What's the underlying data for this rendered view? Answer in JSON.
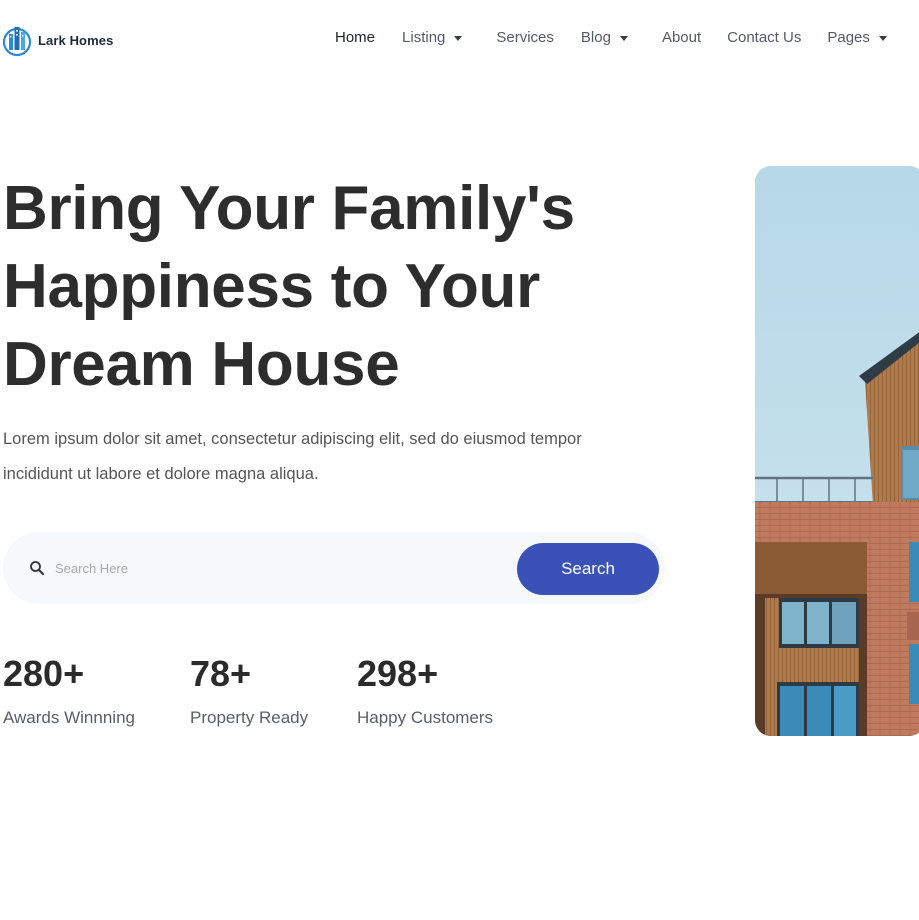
{
  "brand": {
    "name": "Lark Homes",
    "accent_color": "#3a52b8"
  },
  "nav": {
    "items": [
      {
        "label": "Home",
        "active": true,
        "has_dropdown": false
      },
      {
        "label": "Listing",
        "active": false,
        "has_dropdown": true
      },
      {
        "label": "Services",
        "active": false,
        "has_dropdown": false
      },
      {
        "label": "Blog",
        "active": false,
        "has_dropdown": true
      },
      {
        "label": "About",
        "active": false,
        "has_dropdown": false
      },
      {
        "label": "Contact Us",
        "active": false,
        "has_dropdown": false
      },
      {
        "label": "Pages",
        "active": false,
        "has_dropdown": true
      }
    ]
  },
  "hero": {
    "title_line1": "Bring Your Family's",
    "title_line2": "Happiness to Your",
    "title_line3": "Dream House",
    "description_line1": "Lorem ipsum dolor sit amet, consectetur adipiscing elit, sed do eiusmod tempor",
    "description_line2": "incididunt ut labore et dolore magna aliqua."
  },
  "search": {
    "icon": "search-icon",
    "placeholder": "Search Here",
    "value": "",
    "button_label": "Search"
  },
  "stats": [
    {
      "value": "280+",
      "label": "Awards Winnning"
    },
    {
      "value": "78+",
      "label": "Property Ready"
    },
    {
      "value": "298+",
      "label": "Happy Customers"
    }
  ]
}
